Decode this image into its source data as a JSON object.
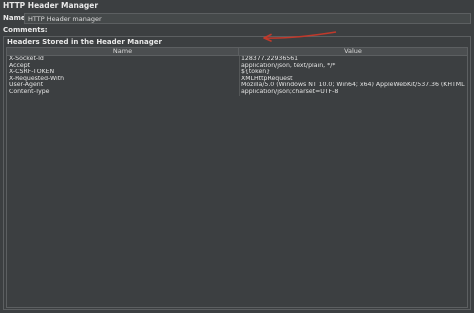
{
  "window": {
    "title": "HTTP Header Manager"
  },
  "form": {
    "name_label": "Name:",
    "name_value": "HTTP Header manager",
    "comments_label": "Comments:"
  },
  "headers_panel": {
    "title": "Headers Stored in the Header Manager",
    "columns": [
      "Name",
      "Value"
    ],
    "rows": [
      {
        "name": "X-Socket-Id",
        "value": "128377.22936561"
      },
      {
        "name": "Accept",
        "value": "application/json, text/plain, */*"
      },
      {
        "name": "X-CSRF-TOKEN",
        "value": "${token}"
      },
      {
        "name": "X-Requested-With",
        "value": "XMLHttpRequest"
      },
      {
        "name": "User-Agent",
        "value": "Mozilla/5.0 (Windows NT 10.0; Win64; x64) AppleWebKit/537.36 (KHTML, like Gecko) Chrome/"
      },
      {
        "name": "Content-Type",
        "value": "application/json;charset=UTF-8"
      }
    ]
  },
  "annotation": {
    "arrow_color": "#c0392b",
    "arrow_icon": "red-arrow-icon"
  }
}
